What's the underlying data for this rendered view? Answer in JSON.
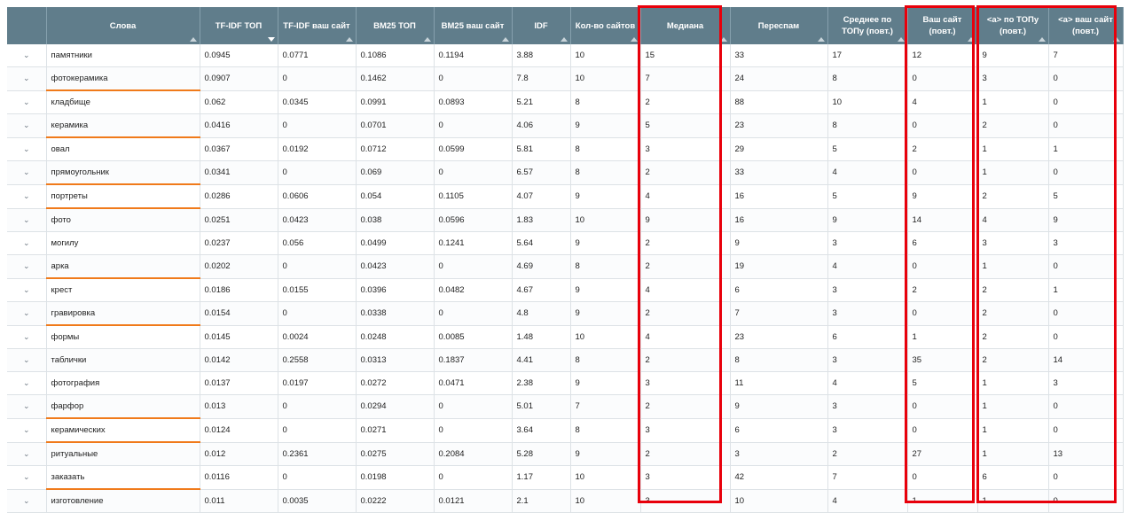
{
  "columns": [
    "",
    "Слова",
    "TF-IDF ТОП",
    "TF-IDF ваш сайт",
    "BM25 ТОП",
    "BM25 ваш сайт",
    "IDF",
    "Кол-во сайтов",
    "Медиана",
    "Переспам",
    "Среднее по ТОПу (повт.)",
    "Ваш сайт (повт.)",
    "<a> по ТОПу (повт.)",
    "<a> ваш сайт (повт.)"
  ],
  "rows": [
    [
      "памятники",
      "0.0945",
      "0.0771",
      "0.1086",
      "0.1194",
      "3.88",
      "10",
      "15",
      "33",
      "17",
      "12",
      "9",
      "7"
    ],
    [
      "фотокерамика",
      "0.0907",
      "0",
      "0.1462",
      "0",
      "7.8",
      "10",
      "7",
      "24",
      "8",
      "0",
      "3",
      "0"
    ],
    [
      "кладбище",
      "0.062",
      "0.0345",
      "0.0991",
      "0.0893",
      "5.21",
      "8",
      "2",
      "88",
      "10",
      "4",
      "1",
      "0"
    ],
    [
      "керамика",
      "0.0416",
      "0",
      "0.0701",
      "0",
      "4.06",
      "9",
      "5",
      "23",
      "8",
      "0",
      "2",
      "0"
    ],
    [
      "овал",
      "0.0367",
      "0.0192",
      "0.0712",
      "0.0599",
      "5.81",
      "8",
      "3",
      "29",
      "5",
      "2",
      "1",
      "1"
    ],
    [
      "прямоугольник",
      "0.0341",
      "0",
      "0.069",
      "0",
      "6.57",
      "8",
      "2",
      "33",
      "4",
      "0",
      "1",
      "0"
    ],
    [
      "портреты",
      "0.0286",
      "0.0606",
      "0.054",
      "0.1105",
      "4.07",
      "9",
      "4",
      "16",
      "5",
      "9",
      "2",
      "5"
    ],
    [
      "фото",
      "0.0251",
      "0.0423",
      "0.038",
      "0.0596",
      "1.83",
      "10",
      "9",
      "16",
      "9",
      "14",
      "4",
      "9"
    ],
    [
      "могилу",
      "0.0237",
      "0.056",
      "0.0499",
      "0.1241",
      "5.64",
      "9",
      "2",
      "9",
      "3",
      "6",
      "3",
      "3"
    ],
    [
      "арка",
      "0.0202",
      "0",
      "0.0423",
      "0",
      "4.69",
      "8",
      "2",
      "19",
      "4",
      "0",
      "1",
      "0"
    ],
    [
      "крест",
      "0.0186",
      "0.0155",
      "0.0396",
      "0.0482",
      "4.67",
      "9",
      "4",
      "6",
      "3",
      "2",
      "2",
      "1"
    ],
    [
      "гравировка",
      "0.0154",
      "0",
      "0.0338",
      "0",
      "4.8",
      "9",
      "2",
      "7",
      "3",
      "0",
      "2",
      "0"
    ],
    [
      "формы",
      "0.0145",
      "0.0024",
      "0.0248",
      "0.0085",
      "1.48",
      "10",
      "4",
      "23",
      "6",
      "1",
      "2",
      "0"
    ],
    [
      "таблички",
      "0.0142",
      "0.2558",
      "0.0313",
      "0.1837",
      "4.41",
      "8",
      "2",
      "8",
      "3",
      "35",
      "2",
      "14"
    ],
    [
      "фотография",
      "0.0137",
      "0.0197",
      "0.0272",
      "0.0471",
      "2.38",
      "9",
      "3",
      "11",
      "4",
      "5",
      "1",
      "3"
    ],
    [
      "фарфор",
      "0.013",
      "0",
      "0.0294",
      "0",
      "5.01",
      "7",
      "2",
      "9",
      "3",
      "0",
      "1",
      "0"
    ],
    [
      "керамических",
      "0.0124",
      "0",
      "0.0271",
      "0",
      "3.64",
      "8",
      "3",
      "6",
      "3",
      "0",
      "1",
      "0"
    ],
    [
      "ритуальные",
      "0.012",
      "0.2361",
      "0.0275",
      "0.2084",
      "5.28",
      "9",
      "2",
      "3",
      "2",
      "27",
      "1",
      "13"
    ],
    [
      "заказать",
      "0.0116",
      "0",
      "0.0198",
      "0",
      "1.17",
      "10",
      "3",
      "42",
      "7",
      "0",
      "6",
      "0"
    ],
    [
      "изготовление",
      "0.011",
      "0.0035",
      "0.0222",
      "0.0121",
      "2.1",
      "10",
      "3",
      "10",
      "4",
      "1",
      "1",
      "0"
    ]
  ],
  "underlined_rows": [
    1,
    3,
    5,
    6,
    9,
    11,
    15,
    16,
    18
  ],
  "colors": {
    "header_bg": "#607d8b",
    "highlight": "#e8000b",
    "underline": "#f07a1a"
  }
}
